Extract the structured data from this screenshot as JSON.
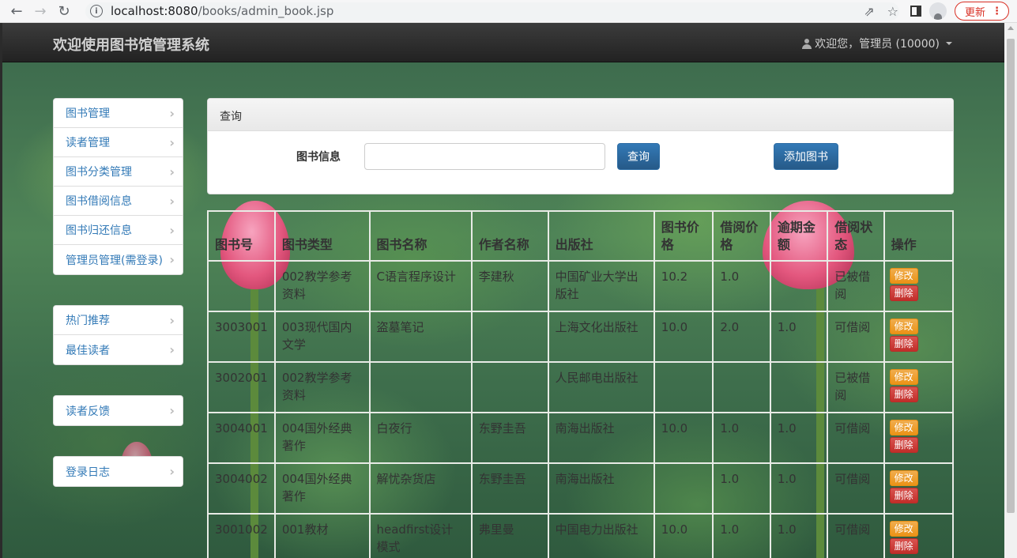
{
  "browser": {
    "url_host": "localhost:8080",
    "url_path": "/books/admin_book.jsp",
    "update_label": "更新"
  },
  "topnav": {
    "brand": "欢迎使用图书馆管理系统",
    "user": "欢迎您，管理员 (10000)"
  },
  "sidebar": {
    "group1": [
      "图书管理",
      "读者管理",
      "图书分类管理",
      "图书借阅信息",
      "图书归还信息",
      "管理员管理(需登录)"
    ],
    "group2": [
      "热门推荐",
      "最佳读者"
    ],
    "group3": [
      "读者反馈"
    ],
    "group4": [
      "登录日志"
    ]
  },
  "query": {
    "panel_title": "查询",
    "label": "图书信息",
    "input_value": "",
    "search_button": "查询",
    "add_button": "添加图书"
  },
  "table": {
    "headers": [
      "图书号",
      "图书类型",
      "图书名称",
      "作者名称",
      "出版社",
      "图书价格",
      "借阅价格",
      "逾期金额",
      "借阅状态",
      "操作"
    ],
    "edit_label": "修改",
    "delete_label": "删除",
    "rows": [
      [
        "",
        "002教学参考资料",
        "C语言程序设计",
        "李建秋",
        "中国矿业大学出版社",
        "10.2",
        "1.0",
        "",
        "已被借阅"
      ],
      [
        "3003001",
        "003现代国内文学",
        "盗墓笔记",
        "",
        "上海文化出版社",
        "10.0",
        "2.0",
        "1.0",
        "可借阅"
      ],
      [
        "3002001",
        "002教学参考资料",
        "",
        "",
        "人民邮电出版社",
        "",
        "",
        "",
        "已被借阅"
      ],
      [
        "3004001",
        "004国外经典著作",
        "白夜行",
        "东野圭吾",
        "南海出版社",
        "10.0",
        "1.0",
        "1.0",
        "可借阅"
      ],
      [
        "3004002",
        "004国外经典著作",
        "解忧杂货店",
        "东野圭吾",
        "南海出版社",
        "",
        "1.0",
        "1.0",
        "可借阅"
      ],
      [
        "3001002",
        "001教材",
        "headfirst设计模式",
        "弗里曼",
        "中国电力出版社",
        "10.0",
        "1.0",
        "1.0",
        "可借阅"
      ]
    ]
  }
}
